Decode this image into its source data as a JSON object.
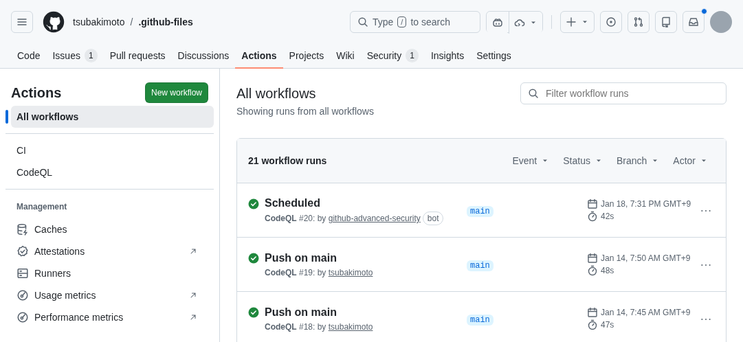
{
  "header": {
    "owner": "tsubakimoto",
    "separator": "/",
    "repo": ".github-files",
    "search": {
      "before": "Type",
      "key": "/",
      "after": "to search"
    },
    "inbox_unread": true
  },
  "tabs": [
    {
      "label": "Code",
      "selected": false
    },
    {
      "label": "Issues",
      "count": "1",
      "selected": false
    },
    {
      "label": "Pull requests",
      "selected": false
    },
    {
      "label": "Discussions",
      "selected": false
    },
    {
      "label": "Actions",
      "selected": true
    },
    {
      "label": "Projects",
      "selected": false
    },
    {
      "label": "Wiki",
      "selected": false
    },
    {
      "label": "Security",
      "count": "1",
      "selected": false
    },
    {
      "label": "Insights",
      "selected": false
    },
    {
      "label": "Settings",
      "selected": false
    }
  ],
  "sidebar": {
    "title": "Actions",
    "new_button": "New workflow",
    "overview": [
      {
        "label": "All workflows",
        "selected": true
      }
    ],
    "workflows": [
      {
        "label": "CI",
        "selected": false
      },
      {
        "label": "CodeQL",
        "selected": false
      }
    ],
    "management": {
      "heading": "Management",
      "items": [
        {
          "label": "Caches",
          "kind": "caches",
          "external": false
        },
        {
          "label": "Attestations",
          "kind": "attestations",
          "external": true
        },
        {
          "label": "Runners",
          "kind": "runners",
          "external": false
        },
        {
          "label": "Usage metrics",
          "kind": "metrics",
          "external": true
        },
        {
          "label": "Performance metrics",
          "kind": "metrics",
          "external": true
        }
      ]
    }
  },
  "main": {
    "title": "All workflows",
    "subtitle": "Showing runs from all workflows",
    "filter": {
      "placeholder": "Filter workflow runs"
    },
    "runs_panel": {
      "count": "21 workflow runs",
      "filters": [
        "Event",
        "Status",
        "Branch",
        "Actor"
      ],
      "runs": [
        {
          "passed": true,
          "title": "Scheduled",
          "meta": "**CodeQL** #20: by",
          "actor": "github-advanced-security",
          "badge": "bot",
          "branch": "main",
          "date": "Jan 18, 7:31 PM GMT+9",
          "duration": "42s"
        },
        {
          "passed": true,
          "title": "Push on main",
          "meta": "**CodeQL** #19: by",
          "actor": "tsubakimoto",
          "branch": "main",
          "date": "Jan 14, 7:50 AM GMT+9",
          "duration": "48s"
        },
        {
          "passed": true,
          "title": "Push on main",
          "meta": "**CodeQL** #18: by",
          "actor": "tsubakimoto",
          "branch": "main",
          "date": "Jan 14, 7:45 AM GMT+9",
          "duration": "47s"
        }
      ]
    }
  }
}
